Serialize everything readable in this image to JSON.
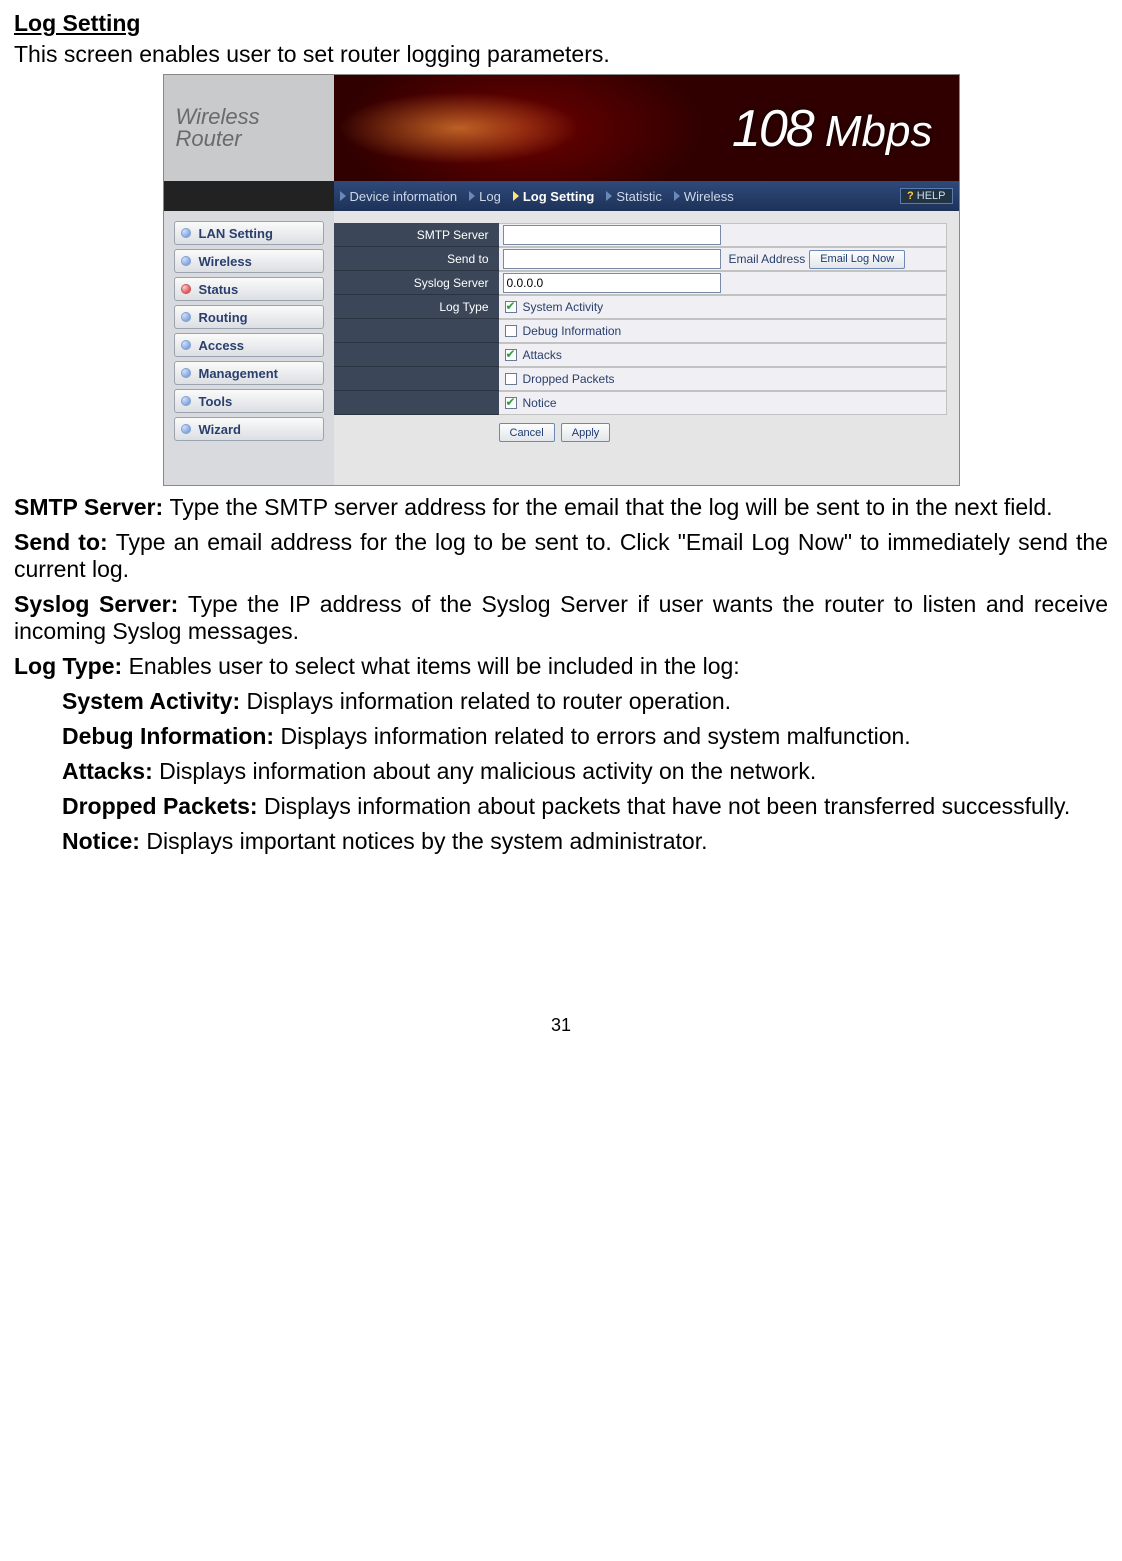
{
  "doc": {
    "heading": "Log Setting",
    "intro": "This screen enables user to set router logging parameters.",
    "page_number": "31"
  },
  "banner": {
    "line1": "Wireless",
    "line2": "Router",
    "rate_num": "108",
    "rate_unit": "Mbps"
  },
  "breadcrumb": {
    "items": [
      {
        "label": "Device information",
        "active": false
      },
      {
        "label": "Log",
        "active": false
      },
      {
        "label": "Log Setting",
        "active": true
      },
      {
        "label": "Statistic",
        "active": false
      },
      {
        "label": "Wireless",
        "active": false
      }
    ],
    "help": "HELP"
  },
  "sidebar": {
    "items": [
      {
        "label": "LAN Setting",
        "selected": false
      },
      {
        "label": "Wireless",
        "selected": false
      },
      {
        "label": "Status",
        "selected": true
      },
      {
        "label": "Routing",
        "selected": false
      },
      {
        "label": "Access",
        "selected": false
      },
      {
        "label": "Management",
        "selected": false
      },
      {
        "label": "Tools",
        "selected": false
      },
      {
        "label": "Wizard",
        "selected": false
      }
    ]
  },
  "form": {
    "smtp_label": "SMTP Server",
    "smtp_value": "",
    "sendto_label": "Send to",
    "sendto_value": "",
    "email_address_label": "Email Address",
    "email_log_now_btn": "Email Log Now",
    "syslog_label": "Syslog Server",
    "syslog_value": "0.0.0.0",
    "logtype_label": "Log Type",
    "options": [
      {
        "label": "System Activity",
        "checked": true
      },
      {
        "label": "Debug Information",
        "checked": false
      },
      {
        "label": "Attacks",
        "checked": true
      },
      {
        "label": "Dropped Packets",
        "checked": false
      },
      {
        "label": "Notice",
        "checked": true
      }
    ],
    "cancel_btn": "Cancel",
    "apply_btn": "Apply"
  },
  "descriptions": {
    "smtp_b": "SMTP Server: ",
    "smtp_t": "Type the SMTP server address for the email that the log will be sent to in the next field.",
    "sendto_b": "Send to: ",
    "sendto_t": "Type an email address for the log to be sent to. Click \"Email Log Now\" to immediately send the current log.",
    "syslog_b": "Syslog Server: ",
    "syslog_t": "Type the IP address of the Syslog Server if user wants the router to listen and receive incoming Syslog messages.",
    "logtype_b": "Log Type: ",
    "logtype_t": "Enables user to select what items will be included in the log:",
    "sysact_b": "System Activity: ",
    "sysact_t": "Displays information related to router operation.",
    "debug_b": "Debug Information: ",
    "debug_t": "Displays information related to errors and system malfunction.",
    "attacks_b": "Attacks: ",
    "attacks_t": "Displays information about any malicious activity on the network.",
    "dropped_b": "Dropped Packets: ",
    "dropped_t": "Displays information about packets that have not been transferred successfully.",
    "notice_b": "Notice: ",
    "notice_t": "Displays important notices by the system administrator."
  }
}
